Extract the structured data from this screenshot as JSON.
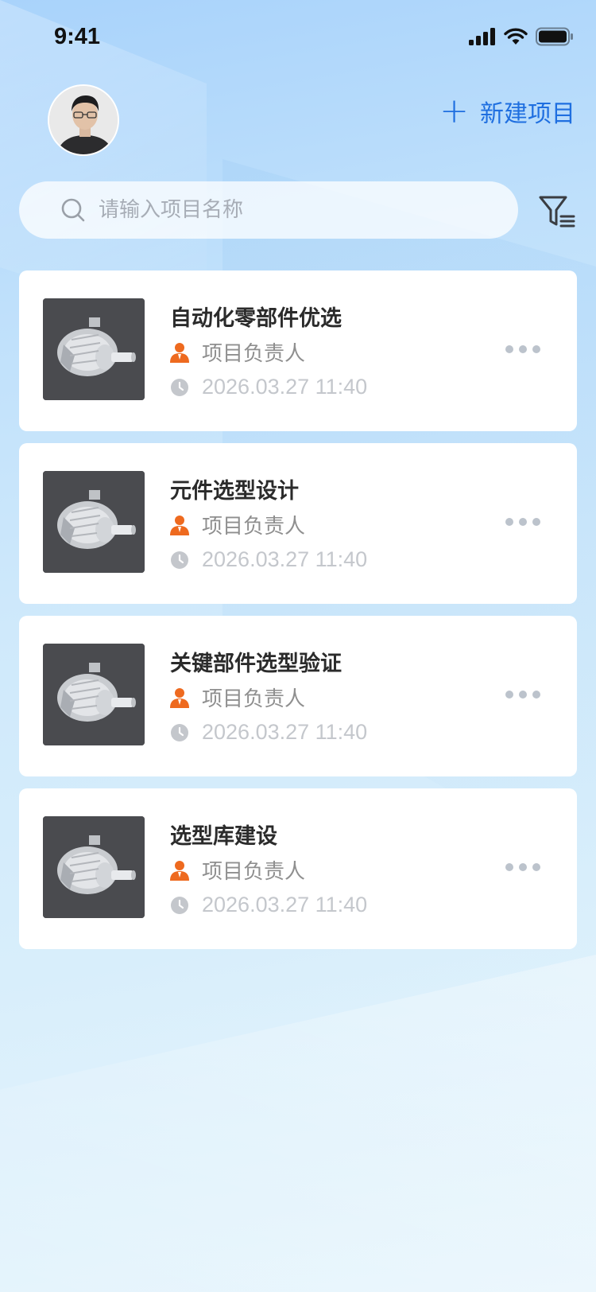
{
  "status_bar": {
    "time": "9:41"
  },
  "header": {
    "new_project_label": "新建项目"
  },
  "search": {
    "placeholder": "请输入项目名称"
  },
  "projects": [
    {
      "title": "自动化零部件优选",
      "owner": "项目负责人",
      "time": "2026.03.27 11:40"
    },
    {
      "title": "元件选型设计",
      "owner": "项目负责人",
      "time": "2026.03.27 11:40"
    },
    {
      "title": "关键部件选型验证",
      "owner": "项目负责人",
      "time": "2026.03.27 11:40"
    },
    {
      "title": "选型库建设",
      "owner": "项目负责人",
      "time": "2026.03.27 11:40"
    }
  ],
  "colors": {
    "accent": "#1f6fe0",
    "owner_icon": "#ee6a1f",
    "muted": "#c4c7cc"
  },
  "icons": [
    "signal-icon",
    "wifi-icon",
    "battery-icon",
    "plus-icon",
    "search-icon",
    "filter-icon",
    "person-icon",
    "clock-icon",
    "more-icon"
  ]
}
